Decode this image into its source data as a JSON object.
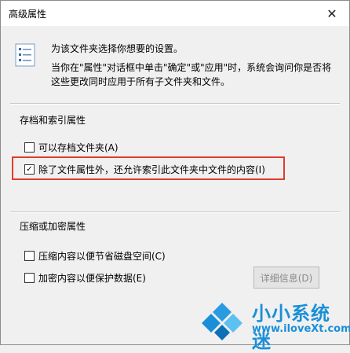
{
  "window": {
    "title": "高级属性",
    "close_glyph": "✕"
  },
  "description": {
    "line1": "为该文件夹选择你想要的设置。",
    "line2": "当你在\"属性\"对话框中单击\"确定\"或\"应用\"时，系统会询问你是否将这些更改同时应用于所有子文件夹和文件。"
  },
  "archive_group": {
    "label": "存档和索引属性",
    "archive_checkbox": {
      "label": "可以存档文件夹(A)",
      "checked": false
    },
    "index_checkbox": {
      "label": "除了文件属性外，还允许索引此文件夹中文件的内容(I)",
      "checked": true,
      "check_glyph": "✓"
    }
  },
  "compress_group": {
    "label": "压缩或加密属性",
    "compress_checkbox": {
      "label": "压缩内容以便节省磁盘空间(C)",
      "checked": false
    },
    "encrypt_checkbox": {
      "label": "加密内容以便保护数据(E)",
      "checked": false
    },
    "details_button": "详细信息(D)"
  },
  "watermark": {
    "name": "小小系统迷",
    "url": "www.iloveXt.com"
  },
  "colors": {
    "highlight": "#e23a2e",
    "watermark": "#1a8fd8"
  }
}
